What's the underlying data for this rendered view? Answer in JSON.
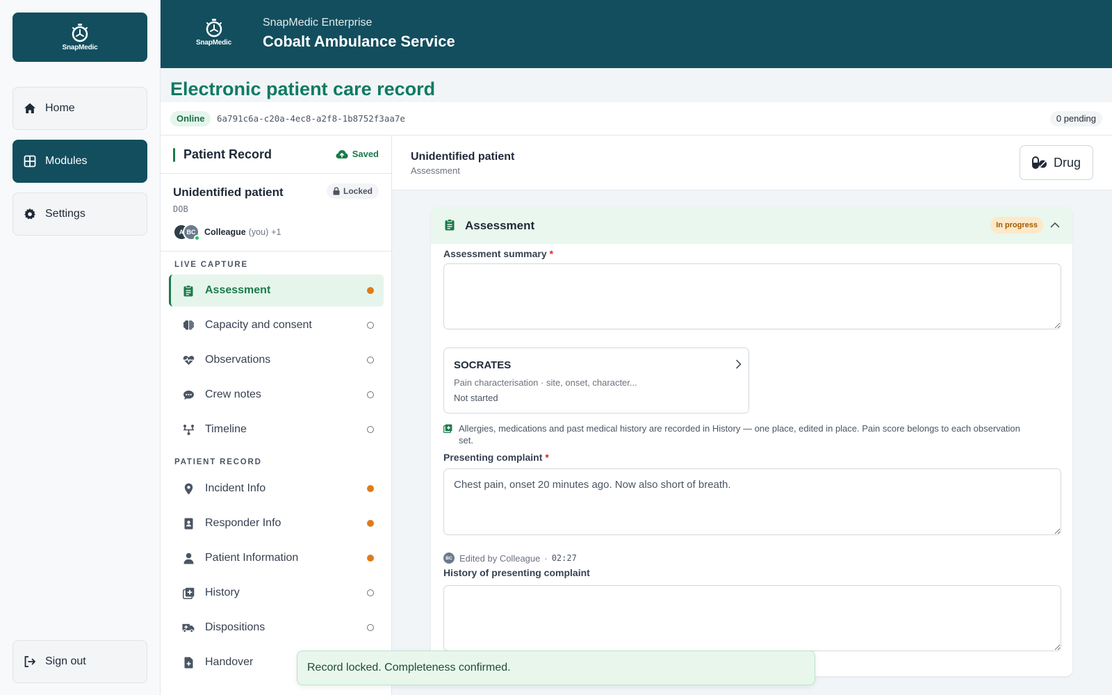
{
  "app": {
    "logo_text": "SnapMedic",
    "nav": [
      {
        "label": "Home",
        "icon": "home-icon"
      },
      {
        "label": "Modules",
        "icon": "grid-icon"
      },
      {
        "label": "Settings",
        "icon": "gear-icon"
      }
    ],
    "sign_out_label": "Sign out"
  },
  "header": {
    "logo_text": "SnapMedic",
    "org_subtitle": "SnapMedic Enterprise",
    "org_title": "Cobalt Ambulance Service"
  },
  "page": {
    "title": "Electronic patient care record"
  },
  "status": {
    "connection": "Online",
    "record_id": "6a791c6a-c20a-4ec8-a2f8-1b8752f3aa7e",
    "pending": "0 pending"
  },
  "record_nav": {
    "title": "Patient Record",
    "save_state": "Saved",
    "patient_name": "Unidentified patient",
    "lock_state": "Locked",
    "dob_label": "DOB",
    "collaborators": {
      "avatar_1": "A",
      "avatar_2": "BC",
      "name": "Colleague",
      "you": "(you)",
      "more": "+1"
    },
    "sections": [
      {
        "label": "LIVE CAPTURE",
        "items": [
          {
            "label": "Assessment",
            "icon": "clipboard-icon",
            "status": "in-progress"
          },
          {
            "label": "Capacity and consent",
            "icon": "brain-icon",
            "status": "empty"
          },
          {
            "label": "Observations",
            "icon": "heart-pulse-icon",
            "status": "empty"
          },
          {
            "label": "Crew notes",
            "icon": "chat-bubble-icon",
            "status": "empty"
          },
          {
            "label": "Timeline",
            "icon": "timeline-icon",
            "status": "empty"
          }
        ]
      },
      {
        "label": "PATIENT RECORD",
        "items": [
          {
            "label": "Incident Info",
            "icon": "map-pin-icon",
            "status": "in-progress"
          },
          {
            "label": "Responder Info",
            "icon": "id-badge-icon",
            "status": "in-progress"
          },
          {
            "label": "Patient Information",
            "icon": "person-icon",
            "status": "in-progress"
          },
          {
            "label": "History",
            "icon": "medical-history-icon",
            "status": "empty"
          },
          {
            "label": "Dispositions",
            "icon": "ambulance-icon",
            "status": "empty"
          },
          {
            "label": "Handover",
            "icon": "document-icon",
            "status": "empty"
          }
        ]
      }
    ]
  },
  "main": {
    "patient_name": "Unidentified patient",
    "context": "Assessment",
    "drug_button": "Drug",
    "card": {
      "title": "Assessment",
      "status": "In progress",
      "summary_label": "Assessment summary",
      "summary_value": "",
      "required_mark": "*",
      "socrates": {
        "title": "SOCRATES",
        "description": "Pain characterisation · site, onset, character...",
        "status": "Not started"
      },
      "note": "Allergies, medications and past medical history are recorded in History — one place, edited in place. Pain score belongs to each observation set.",
      "complaint_label": "Presenting complaint",
      "complaint_value": "Chest pain, onset 20 minutes ago. Now also short of breath.",
      "edited": {
        "avatar": "BC",
        "text": "Edited by Colleague",
        "separator": "·",
        "time": "02:27"
      },
      "hpc_label": "History of presenting complaint",
      "hpc_value": ""
    }
  },
  "toast": {
    "message": "Record locked. Completeness confirmed."
  },
  "colors": {
    "brand_dark": "#134e5e",
    "accent_green": "#1b7a4a",
    "title_green": "#0f7a64",
    "status_orange": "#e07b1b"
  }
}
